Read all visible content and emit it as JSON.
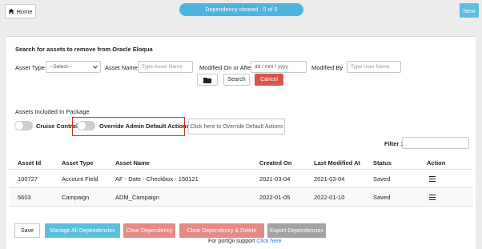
{
  "topbar": {
    "home_label": "Home",
    "dependency_status": "Dependency cleared : 0 of 0",
    "new_label": "New"
  },
  "search": {
    "title": "Search for assets to remove from Oracle Eloqua",
    "asset_type_label": "Asset Type",
    "asset_type_value": "--Select--",
    "asset_name_label": "Asset Name",
    "asset_name_placeholder": "Type Asset Name",
    "modified_on_label": "Modified On or After",
    "modified_on_placeholder": "dd / mm / yyyy",
    "modified_by_label": "Modified By",
    "modified_by_placeholder": "Type User Name",
    "search_label": "Search",
    "cancel_label": "Cancel"
  },
  "package": {
    "title": "Assets Included In Package",
    "cruise_control_label": "Cruise Control",
    "override_label": "Override Admin Default Actions",
    "override_default_button": "Click here to Override Default Actions",
    "filter_label": "Filter :"
  },
  "table": {
    "headers": [
      "Asset Id",
      "Asset Type",
      "Asset Name",
      "Created On",
      "Last Modified At",
      "Status",
      "Action"
    ],
    "rows": [
      {
        "asset_id": "100727",
        "asset_type": "Account Field",
        "asset_name": "AF - Date - Checkbox - 150121",
        "created_on": "2021-03-04",
        "last_modified": "2021-03-04",
        "status": "Saved"
      },
      {
        "asset_id": "5603",
        "asset_type": "Campaign",
        "asset_name": "ADM_Campaign",
        "created_on": "2022-01-05",
        "last_modified": "2022-01-10",
        "status": "Saved"
      }
    ]
  },
  "footer": {
    "save_label": "Save",
    "manage_label": "Manage All Dependencies",
    "clear_label": "Clear Dependency",
    "clear_delete_label": "Clear Dependency & Delete",
    "export_label": "Export Dependencies",
    "support_text": "For portQii support",
    "support_link": "Click here"
  },
  "colors": {
    "accent": "#4fb3de",
    "cancel": "#d9534f",
    "clear": "#e68a87",
    "highlight_border": "#d62f2f"
  },
  "icons": [
    "home-icon",
    "folder-icon",
    "chevron-down-icon",
    "menu-icon"
  ]
}
